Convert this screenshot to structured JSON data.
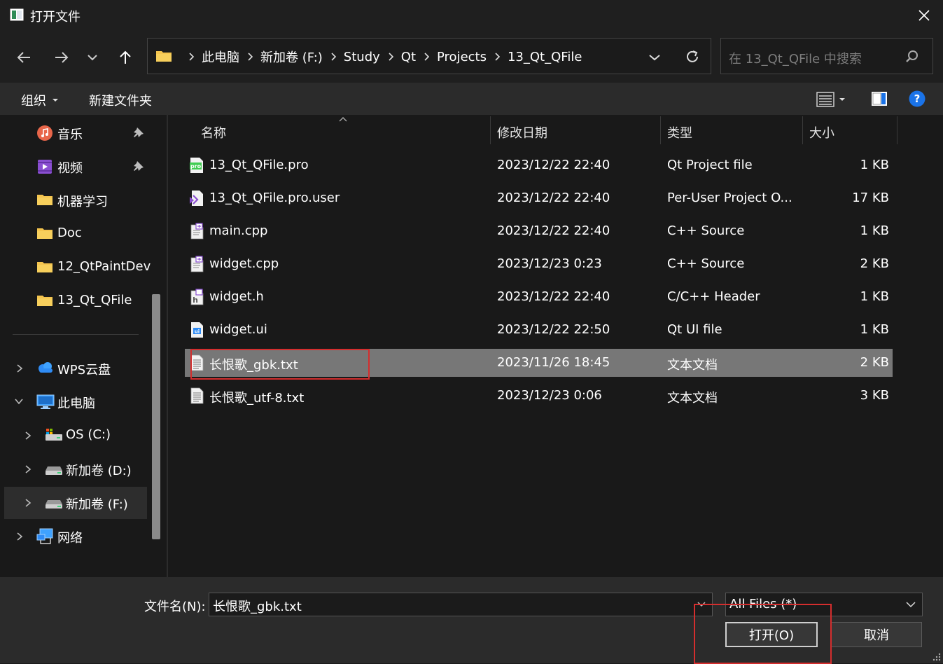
{
  "window": {
    "title": "打开文件",
    "icon": "window-icon",
    "close_icon": "close-icon"
  },
  "nav": {
    "back_icon": "arrow-left-icon",
    "forward_icon": "arrow-right-icon",
    "recent_icon": "chevron-down-icon",
    "up_icon": "arrow-up-icon",
    "breadcrumbs": [
      "此电脑",
      "新加卷 (F:)",
      "Study",
      "Qt",
      "Projects",
      "13_Qt_QFile"
    ],
    "refresh_icon": "refresh-icon",
    "search_placeholder": "在 13_Qt_QFile 中搜索"
  },
  "toolbar": {
    "organize": "组织",
    "new_folder": "新建文件夹"
  },
  "sidebar": {
    "quick_access": [
      {
        "label": "音乐",
        "icon": "music-icon",
        "pinned": true
      },
      {
        "label": "视频",
        "icon": "video-icon",
        "pinned": true
      },
      {
        "label": "机器学习",
        "icon": "folder-icon"
      },
      {
        "label": "Doc",
        "icon": "folder-icon"
      },
      {
        "label": "12_QtPaintDev",
        "icon": "folder-icon"
      },
      {
        "label": "13_Qt_QFile",
        "icon": "folder-icon"
      }
    ],
    "tree": [
      {
        "label": "WPS云盘",
        "icon": "cloud-icon",
        "expanded": false
      },
      {
        "label": "此电脑",
        "icon": "computer-icon",
        "expanded": true
      },
      {
        "label": "OS (C:)",
        "icon": "drive-icon"
      },
      {
        "label": "新加卷 (D:)",
        "icon": "drive-icon"
      },
      {
        "label": "新加卷 (F:)",
        "icon": "drive-icon",
        "selected": true
      },
      {
        "label": "网络",
        "icon": "network-icon",
        "expanded": false
      }
    ]
  },
  "file_list": {
    "columns": {
      "name": "名称",
      "date": "修改日期",
      "type": "类型",
      "size": "大小"
    },
    "files": [
      {
        "name": "13_Qt_QFile.pro",
        "date": "2023/12/22 22:40",
        "type": "Qt Project file",
        "size": "1 KB",
        "icon": "qt-pro-file-icon"
      },
      {
        "name": "13_Qt_QFile.pro.user",
        "date": "2023/12/22 22:40",
        "type": "Per-User Project O...",
        "size": "17 KB",
        "icon": "user-project-file-icon"
      },
      {
        "name": "main.cpp",
        "date": "2023/12/22 22:40",
        "type": "C++ Source",
        "size": "1 KB",
        "icon": "cpp-file-icon"
      },
      {
        "name": "widget.cpp",
        "date": "2023/12/23 0:23",
        "type": "C++ Source",
        "size": "2 KB",
        "icon": "cpp-file-icon"
      },
      {
        "name": "widget.h",
        "date": "2023/12/22 22:40",
        "type": "C/C++ Header",
        "size": "1 KB",
        "icon": "header-file-icon"
      },
      {
        "name": "widget.ui",
        "date": "2023/12/22 22:50",
        "type": "Qt UI file",
        "size": "1 KB",
        "icon": "qt-ui-file-icon"
      },
      {
        "name": "长恨歌_gbk.txt",
        "date": "2023/11/26 18:45",
        "type": "文本文档",
        "size": "2 KB",
        "icon": "text-file-icon",
        "selected": true
      },
      {
        "name": "长恨歌_utf-8.txt",
        "date": "2023/12/23 0:06",
        "type": "文本文档",
        "size": "3 KB",
        "icon": "text-file-icon"
      }
    ]
  },
  "footer": {
    "filename_label": "文件名(N):",
    "filename_value": "长恨歌_gbk.txt",
    "filetype_value": "All Files (*)",
    "open_button": "打开(O)",
    "cancel_button": "取消"
  },
  "colors": {
    "accent": "#1a73e8",
    "selection": "#777777",
    "highlight": "#d42e2e",
    "folder": "#f4c44e"
  }
}
